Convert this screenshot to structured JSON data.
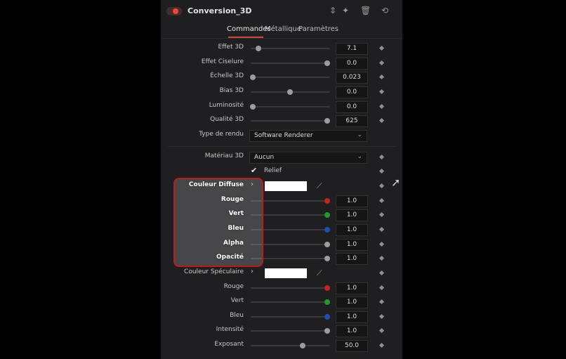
{
  "header": {
    "title": "Conversion_3D",
    "icons": [
      "power-toggle",
      "reorder-icon",
      "magic-wand-icon",
      "trash-icon",
      "reset-icon"
    ]
  },
  "tabs": [
    {
      "label": "Commandes",
      "active": true
    },
    {
      "label": "Métallique",
      "active": false
    },
    {
      "label": "Paramètres",
      "active": false
    }
  ],
  "params": {
    "effet3d": {
      "label": "Effet 3D",
      "value": "7.1",
      "slider": 0.1
    },
    "effetciselure": {
      "label": "Effet Ciselure",
      "value": "0.0",
      "slider": 0.97
    },
    "echelle3d": {
      "label": "Échelle 3D",
      "value": "0.023",
      "slider": 0.03
    },
    "bias3d": {
      "label": "Bias 3D",
      "value": "0.0",
      "slider": 0.5
    },
    "luminosite": {
      "label": "Luminosité",
      "value": "0.0",
      "slider": 0.03
    },
    "qualite3d": {
      "label": "Qualité 3D",
      "value": "625",
      "slider": 0.97
    },
    "typerendu": {
      "label": "Type de rendu",
      "value": "Software Renderer"
    },
    "materiau3d": {
      "label": "Matériau 3D",
      "value": "Aucun"
    },
    "relief": {
      "label": "Relief",
      "checked": true
    }
  },
  "diffuse": {
    "label": "Couleur Diffuse",
    "rouge": {
      "label": "Rouge",
      "value": "1.0"
    },
    "vert": {
      "label": "Vert",
      "value": "1.0"
    },
    "bleu": {
      "label": "Bleu",
      "value": "1.0"
    },
    "alpha": {
      "label": "Alpha",
      "value": "1.0"
    },
    "opacite": {
      "label": "Opacité",
      "value": "1.0"
    }
  },
  "specular": {
    "label": "Couleur Spéculaire",
    "rouge": {
      "label": "Rouge",
      "value": "1.0"
    },
    "vert": {
      "label": "Vert",
      "value": "1.0"
    },
    "bleu": {
      "label": "Bleu",
      "value": "1.0"
    },
    "intensite": {
      "label": "Intensité",
      "value": "1.0"
    },
    "exposant": {
      "label": "Exposant",
      "value": "50.0",
      "slider": 0.66
    }
  },
  "colors": {
    "red": "#c0281c",
    "green": "#1e9a2c",
    "blue": "#1c4fb0",
    "accent": "#d14a3c"
  }
}
